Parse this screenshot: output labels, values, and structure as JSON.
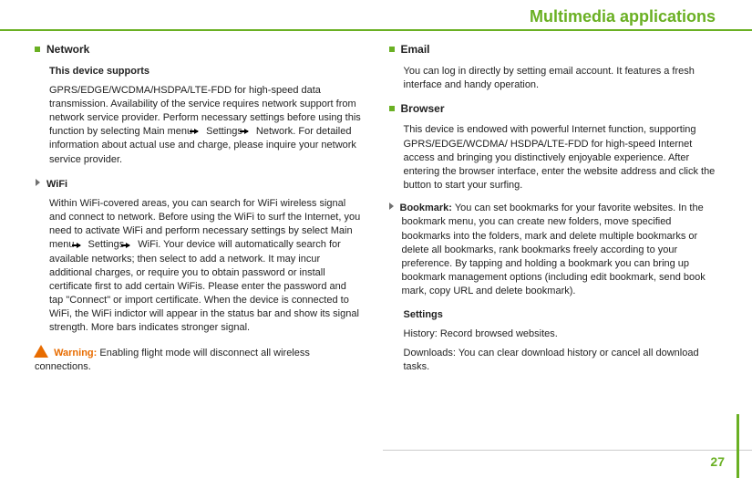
{
  "title": "Multimedia applications",
  "page_number": "27",
  "left": {
    "network": {
      "heading": "Network",
      "sub": "This device supports",
      "p1a": "GPRS/EDGE/WCDMA/HSDPA/LTE-FDD for high-speed data transmission. Availability of the service requires network support from network service provider. Perform necessary settings before using this function by selecting Main menu",
      "p1b": "Settings",
      "p1c": "Network. For detailed information about actual use and charge, please inquire your network service provider."
    },
    "wifi": {
      "heading": "WiFi",
      "p1a": "Within WiFi-covered areas, you can search for WiFi wireless signal and connect to network. Before using the WiFi to surf the Internet, you need to activate WiFi and perform necessary settings by select Main menu",
      "p1b": "Settings",
      "p1c": "WiFi. Your device will automatically search for available networks; then select to add a network. It may incur additional charges, or require you to obtain password or install certificate first to add certain WiFis. Please enter the password and tap \"Connect\" or import certificate. When the device is connected to WiFi, the WiFi indictor will appear in the status bar and show its signal strength. More bars indicates stronger signal."
    },
    "warning": {
      "label": "Warning:",
      "text": " Enabling flight mode will disconnect all wireless connections."
    }
  },
  "right": {
    "email": {
      "heading": "Email",
      "p": "You can log in directly by setting email account. It features a fresh interface and handy operation."
    },
    "browser": {
      "heading": "Browser",
      "p": "This device is endowed with powerful Internet function, supporting GPRS/EDGE/WCDMA/ HSDPA/LTE-FDD for high-speed Internet access and bringing you distinctively enjoyable experience. After entering the browser interface, enter the website address and click the button to start your surfing."
    },
    "bookmark": {
      "label": "Bookmark:",
      "text": " You can set bookmarks for your favorite websites. In the bookmark menu, you can create new folders, move specified bookmarks into the folders, mark and delete multiple bookmarks or delete all bookmarks, rank bookmarks freely according to your preference. By tapping and holding a bookmark you can bring up bookmark management options (including edit bookmark, send book mark, copy URL and delete bookmark)."
    },
    "settings": {
      "heading": "Settings",
      "history": "History: Record browsed websites.",
      "downloads": "Downloads: You can clear download history or cancel all download tasks."
    }
  }
}
